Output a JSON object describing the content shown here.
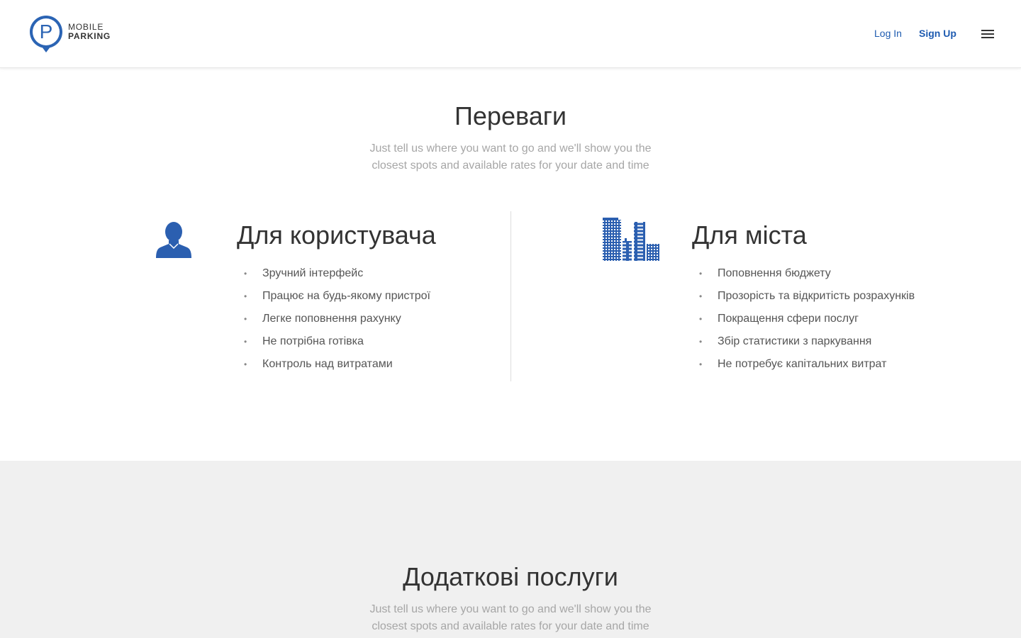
{
  "header": {
    "logo": {
      "line1": "MOBILE",
      "line2": "PARKING",
      "mark_letter": "P",
      "icon": "parking-pin-icon"
    },
    "nav": {
      "login": "Log In",
      "signup": "Sign Up"
    },
    "menu_icon": "hamburger-menu-icon"
  },
  "advantages": {
    "title": "Переваги",
    "subtitle_line1": "Just tell us where you want to go and we'll show you the",
    "subtitle_line2": "closest spots and available rates for your date and time",
    "user": {
      "icon": "user-icon",
      "title": "Для користувача",
      "items": [
        "Зручний інтерфейс",
        "Працює на будь-якому пристрої",
        "Легке поповнення рахунку",
        "Не потрібна готівка",
        "Контроль над витратами"
      ]
    },
    "city": {
      "icon": "city-buildings-icon",
      "title": "Для міста",
      "items": [
        "Поповнення бюджету",
        "Прозорість та відкритість розрахунків",
        "Покращення сфери послуг",
        "Збір статистики з паркування",
        "Не потребує капітальних витрат"
      ]
    },
    "bullet": "•"
  },
  "services": {
    "title": "Додаткові послуги",
    "subtitle_line1": "Just tell us where you want to go and we'll show you the",
    "subtitle_line2": "closest spots and available rates for your date and time"
  },
  "colors": {
    "brand_blue": "#1e5bb0",
    "icon_blue": "#2b5fb0",
    "text_dark": "#333333",
    "text_muted": "#a6a6a6",
    "section_gray": "#f0f0f0"
  }
}
